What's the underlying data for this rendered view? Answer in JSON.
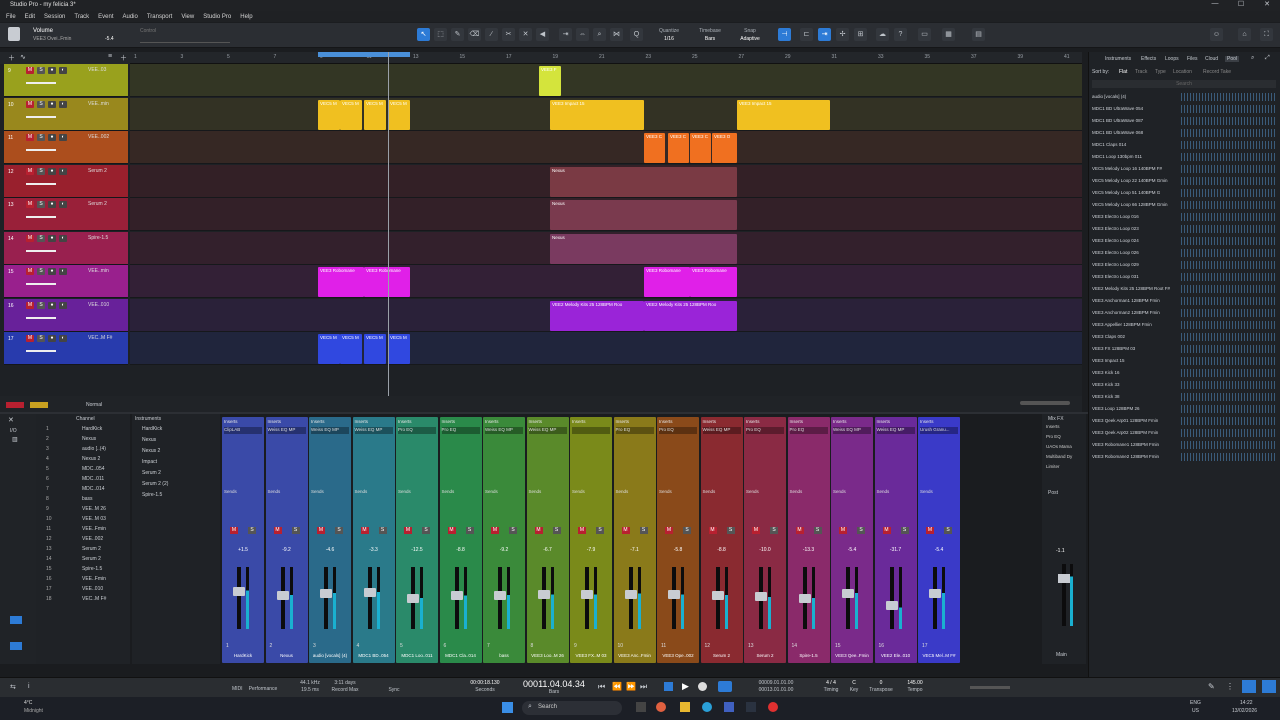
{
  "window": {
    "title": "Studio Pro - my felicia 3*",
    "controls": [
      "—",
      "☐",
      "✕"
    ]
  },
  "menu": [
    "File",
    "Edit",
    "Session",
    "Track",
    "Event",
    "Audio",
    "Transport",
    "View",
    "Studio Pro",
    "Help"
  ],
  "toolbar": {
    "param_name": "Volume",
    "param_track": "VEE3 Ovei..Fmin",
    "param_value": "-5.4",
    "control_label": "Control",
    "quantize_label": "Quantize",
    "quantize_value": "1/16",
    "timebase_label": "Timebase",
    "timebase_value": "Bars",
    "snap_label": "Snap",
    "snap_value": "Adaptive"
  },
  "ruler": [
    "1",
    "3",
    "5",
    "7",
    "9",
    "11",
    "13",
    "15",
    "17",
    "19",
    "21",
    "23",
    "25",
    "27",
    "29",
    "31",
    "33",
    "35",
    "37",
    "39",
    "41"
  ],
  "tracks": [
    {
      "num": "9",
      "name": "VEE..03",
      "color": "#b8c21c"
    },
    {
      "num": "10",
      "name": "VEE..min",
      "color": "#b8a21c"
    },
    {
      "num": "11",
      "name": "VEE..002",
      "color": "#d05a1c"
    },
    {
      "num": "12",
      "name": "Serum 2",
      "color": "#b82030"
    },
    {
      "num": "13",
      "name": "Serum 2",
      "color": "#b8203e"
    },
    {
      "num": "14",
      "name": "Spire-1.5",
      "color": "#b8205a"
    },
    {
      "num": "15",
      "name": "VEE..min",
      "color": "#b820a8"
    },
    {
      "num": "16",
      "name": "VEE..010",
      "color": "#7a22b8"
    },
    {
      "num": "17",
      "name": "VEC..M F#",
      "color": "#2a42d0"
    }
  ],
  "clips": [
    {
      "lane": 0,
      "label": "VEE3 F",
      "color": "#d4e43c"
    },
    {
      "lane": 1,
      "label": "VEC5 M",
      "color": "#f0c020"
    },
    {
      "lane": 1,
      "label": "VEC5 M",
      "color": "#f0c020"
    },
    {
      "lane": 1,
      "label": "VEC5 M",
      "color": "#f0c020"
    },
    {
      "lane": 1,
      "label": "VEC5 M",
      "color": "#f0c020"
    },
    {
      "lane": 1,
      "label": "VEE3 Impact 15",
      "color": "#f0c020"
    },
    {
      "lane": 1,
      "label": "VEE3 Impact 15",
      "color": "#f0c020"
    },
    {
      "lane": 2,
      "label": "VEE3 C",
      "color": "#f07020"
    },
    {
      "lane": 2,
      "label": "VEE3 C",
      "color": "#f07020"
    },
    {
      "lane": 2,
      "label": "VEE3 C",
      "color": "#f07020"
    },
    {
      "lane": 2,
      "label": "VEE3 O",
      "color": "#f07020"
    },
    {
      "lane": 3,
      "label": "Nexus",
      "color": "#7a3a44"
    },
    {
      "lane": 4,
      "label": "Nexus",
      "color": "#7a3a4e"
    },
    {
      "lane": 5,
      "label": "Nexus",
      "color": "#7a3a60"
    },
    {
      "lane": 6,
      "label": "VEE3 Robomane",
      "color": "#e020e8"
    },
    {
      "lane": 6,
      "label": "VEE3 Robomane",
      "color": "#e020e8"
    },
    {
      "lane": 6,
      "label": "VEE3 Robomane",
      "color": "#e020e8"
    },
    {
      "lane": 6,
      "label": "VEE3 Robomane",
      "color": "#e020e8"
    },
    {
      "lane": 7,
      "label": "VEE2 Melody Kits 25 128BPM Roo",
      "color": "#9a24d8"
    },
    {
      "lane": 7,
      "label": "VEE2 Melody Kits 25 128BPM Roo",
      "color": "#9a24d8"
    },
    {
      "lane": 8,
      "label": "VEC5 M",
      "color": "#3048e0"
    },
    {
      "lane": 8,
      "label": "VEC5 M",
      "color": "#3048e0"
    },
    {
      "lane": 8,
      "label": "VEC5 M",
      "color": "#3048e0"
    },
    {
      "lane": 8,
      "label": "VEC5 M",
      "color": "#3048e0"
    }
  ],
  "browser": {
    "tabs": [
      "Instruments",
      "Effects",
      "Loops",
      "Files",
      "Cloud",
      "Pool"
    ],
    "sort_label": "Sort by:",
    "sort_options": [
      "Flat",
      "Track",
      "Type",
      "Location",
      "Record Take"
    ],
    "search_placeholder": "Search",
    "items": [
      "audio [vocals] (4)",
      "MDC1 BD UltraWave 054",
      "MDC1 BD UltraWave 087",
      "MDC1 BD UltraWave 068",
      "MDC1 Claps 014",
      "MDC1 Loop 130bpm 011",
      "VEC5 Melody Loop 16 140BPM F#",
      "VEC5 Melody Loop 22 140BPM Gmin",
      "VEC5 Melody Loop 51 140BPM G",
      "VEC5 Melody Loop 66 128BPM Gmin",
      "VEE3 Electro Loop 016",
      "VEE3 Electro Loop 023",
      "VEE3 Electro Loop 024",
      "VEE3 Electro Loop 026",
      "VEE3 Electro Loop 029",
      "VEE3 Electro Loop 031",
      "VEE2 Melody Kits 25 128BPM Root F#",
      "VEE3 Anchorman1 128BPM Fmin",
      "VEE3 Anchorman2 128BPM Fmin",
      "VEE3 Appellier 128BPM Fmin",
      "VEE3 Claps 002",
      "VEE3 FX 128BPM 03",
      "VEE3 Impact 15",
      "VEE3 Kick 16",
      "VEE3 Kick 33",
      "VEE3 Kick 38",
      "VEE3 Loop 128BPM 26",
      "VEE3 Qeek Arp01 128BPM Fmin",
      "VEE3 Qeek Arp02 128BPM Fmin",
      "VEE3 Robomane1 128BPM Fmin",
      "VEE3 Robomane2 128BPM Fmin"
    ]
  },
  "channel_list": {
    "header": "Channel",
    "items": [
      "HardKick",
      "Nexus",
      "audio [..(4)",
      "Nexus 2",
      "MDC..054",
      "MDC..011",
      "MDC..014",
      "bass",
      "VEE..M 26",
      "VEE..M 03",
      "VEE..Fmin",
      "VEE..002",
      "Serum 2",
      "Serum 2",
      "Spire-1.5",
      "VEE..Fmin",
      "VEE..010",
      "VEC..M F#"
    ]
  },
  "instrument_list": {
    "header": "Instruments",
    "items": [
      "HardKick",
      "Nexus",
      "Nexus 2",
      "Impact",
      "Serum 2",
      "Serum 2 (2)",
      "Spire-1.5"
    ]
  },
  "mixer": [
    {
      "num": "1",
      "name": "HardKick",
      "vol": "+1.5",
      "insert": "ClipLAB",
      "color": "#3a4aa8"
    },
    {
      "num": "2",
      "name": "Nexus",
      "vol": "-9.2",
      "insert": "Weiss EQ MP",
      "color": "#3a4aa8"
    },
    {
      "num": "3",
      "name": "audio [vocals] (4)",
      "vol": "-4.6",
      "insert": "Weiss EQ MP",
      "color": "#2a6a8a"
    },
    {
      "num": "4",
      "name": "MDC1 BD..054",
      "vol": "-3.3",
      "insert": "Weiss EQ MP",
      "color": "#2a7a8a"
    },
    {
      "num": "5",
      "name": "MDC1 Loo..011",
      "vol": "-12.5",
      "insert": "Pro EQ",
      "color": "#2a8a6a"
    },
    {
      "num": "6",
      "name": "MDC1 Cla..014",
      "vol": "-8.8",
      "insert": "Pro EQ",
      "color": "#2a8a4a"
    },
    {
      "num": "7",
      "name": "bass",
      "vol": "-9.2",
      "insert": "Weiss EQ MP",
      "color": "#3a8a3a"
    },
    {
      "num": "8",
      "name": "VEE3 Loo..M 26",
      "vol": "-6.7",
      "insert": "Weiss EQ MP",
      "color": "#5a8a2a"
    },
    {
      "num": "9",
      "name": "VEE3 FX..M 03",
      "vol": "-7.9",
      "insert": "",
      "color": "#7a8a1a"
    },
    {
      "num": "10",
      "name": "VEE3 Anc..Fmin",
      "vol": "-7.1",
      "insert": "Pro EQ",
      "color": "#8a7a1a"
    },
    {
      "num": "11",
      "name": "VEE3 Ope..002",
      "vol": "-5.8",
      "insert": "Pro EQ",
      "color": "#8a4a1a"
    },
    {
      "num": "12",
      "name": "Serum 2",
      "vol": "-8.8",
      "insert": "Weiss EQ MP",
      "color": "#8a2a30"
    },
    {
      "num": "13",
      "name": "Serum 2",
      "vol": "-10.0",
      "insert": "Pro EQ",
      "color": "#8a2a44"
    },
    {
      "num": "14",
      "name": "Spire-1.5",
      "vol": "-13.3",
      "insert": "Pro EQ",
      "color": "#8a2a6a"
    },
    {
      "num": "15",
      "name": "VEE3 Qee..Fmin",
      "vol": "-5.4",
      "insert": "Weiss EQ MP",
      "color": "#7a2a8a"
    },
    {
      "num": "16",
      "name": "VEE2 Ele..010",
      "vol": "-31.7",
      "insert": "Weiss EQ MP",
      "color": "#6a2a9a"
    },
    {
      "num": "17",
      "name": "VEC5 Mel..M F#",
      "vol": "-5.4",
      "insert": "Urush Granu...",
      "color": "#3a3ac8"
    }
  ],
  "mixer_levels": [
    0.62,
    0.55,
    0.58,
    0.6,
    0.5,
    0.54,
    0.55,
    0.56,
    0.56,
    0.57,
    0.56,
    0.55,
    0.52,
    0.5,
    0.58,
    0.35,
    0.58
  ],
  "mixfx": {
    "label": "Mix FX",
    "items": [
      "Inserts",
      "Pro EQ",
      "UAOs Mama",
      "Multiband Dy",
      "Limiter"
    ],
    "main_label": "Main",
    "main_vol": "-1.1",
    "post_label": "Post"
  },
  "transport": {
    "sample_rate": "44.1 kHz",
    "latency": "19.5 ms",
    "record_days": "3:11 days",
    "record_label": "Record Max",
    "time_seconds": "00:00:18.130",
    "seconds_label": "Seconds",
    "position": "00011.04.04.34",
    "bars_label": "Bars",
    "loop_start": "00009.01.01.00",
    "loop_end": "00013.01.01.00",
    "signature": "4 / 4",
    "key": "C",
    "transpose": "0",
    "tempo": "145.00",
    "timing_label": "Timing",
    "key_label": "Key",
    "transpose_label": "Transpose",
    "tempo_label": "Tempo",
    "midi_label": "MIDI",
    "perf_label": "Performance",
    "sync_label": "Sync"
  },
  "taskbar": {
    "temp": "4°C",
    "weather": "Midnight",
    "search": "Search",
    "lang": "ENG",
    "region": "US",
    "time": "14:22",
    "date": "13/02/2026"
  }
}
